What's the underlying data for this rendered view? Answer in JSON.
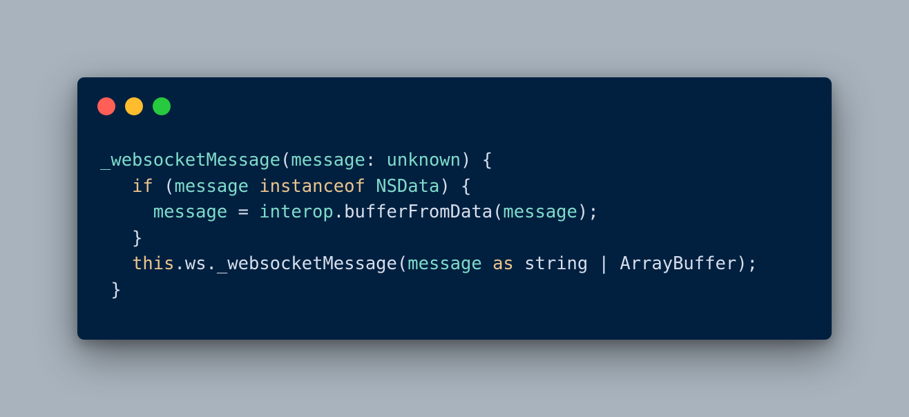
{
  "colors": {
    "background": "#a8b3bd",
    "window": "#012040",
    "close": "#ff5f56",
    "minimize": "#ffbd2e",
    "maximize": "#27c93f",
    "text_default": "#d6deeb",
    "text_cyan": "#7fdbca",
    "text_yellow": "#ecc48d"
  },
  "window": {
    "buttons": [
      {
        "name": "close",
        "icon": "close-dot"
      },
      {
        "name": "minimize",
        "icon": "minimize-dot"
      },
      {
        "name": "maximize",
        "icon": "maximize-dot"
      }
    ]
  },
  "code": {
    "language": "typescript",
    "lines": [
      [
        {
          "t": "_websocketMessage",
          "c": "cyan"
        },
        {
          "t": "(",
          "c": "default"
        },
        {
          "t": "message",
          "c": "cyan"
        },
        {
          "t": ": ",
          "c": "default"
        },
        {
          "t": "unknown",
          "c": "cyan"
        },
        {
          "t": ") {",
          "c": "default"
        }
      ],
      [
        {
          "t": "   ",
          "c": "default"
        },
        {
          "t": "if",
          "c": "yellow"
        },
        {
          "t": " (",
          "c": "default"
        },
        {
          "t": "message",
          "c": "cyan"
        },
        {
          "t": " ",
          "c": "default"
        },
        {
          "t": "instanceof",
          "c": "yellow"
        },
        {
          "t": " ",
          "c": "default"
        },
        {
          "t": "NSData",
          "c": "cyan"
        },
        {
          "t": ") {",
          "c": "default"
        }
      ],
      [
        {
          "t": "     ",
          "c": "default"
        },
        {
          "t": "message",
          "c": "cyan"
        },
        {
          "t": " = ",
          "c": "default"
        },
        {
          "t": "interop",
          "c": "cyan"
        },
        {
          "t": ".bufferFromData(",
          "c": "default"
        },
        {
          "t": "message",
          "c": "cyan"
        },
        {
          "t": ");",
          "c": "default"
        }
      ],
      [
        {
          "t": "   }",
          "c": "default"
        }
      ],
      [
        {
          "t": "   ",
          "c": "default"
        },
        {
          "t": "this",
          "c": "yellow"
        },
        {
          "t": ".ws._websocketMessage(",
          "c": "default"
        },
        {
          "t": "message",
          "c": "cyan"
        },
        {
          "t": " ",
          "c": "default"
        },
        {
          "t": "as",
          "c": "yellow"
        },
        {
          "t": " string | ArrayBuffer);",
          "c": "default"
        }
      ],
      [
        {
          "t": " }",
          "c": "default"
        }
      ]
    ]
  }
}
